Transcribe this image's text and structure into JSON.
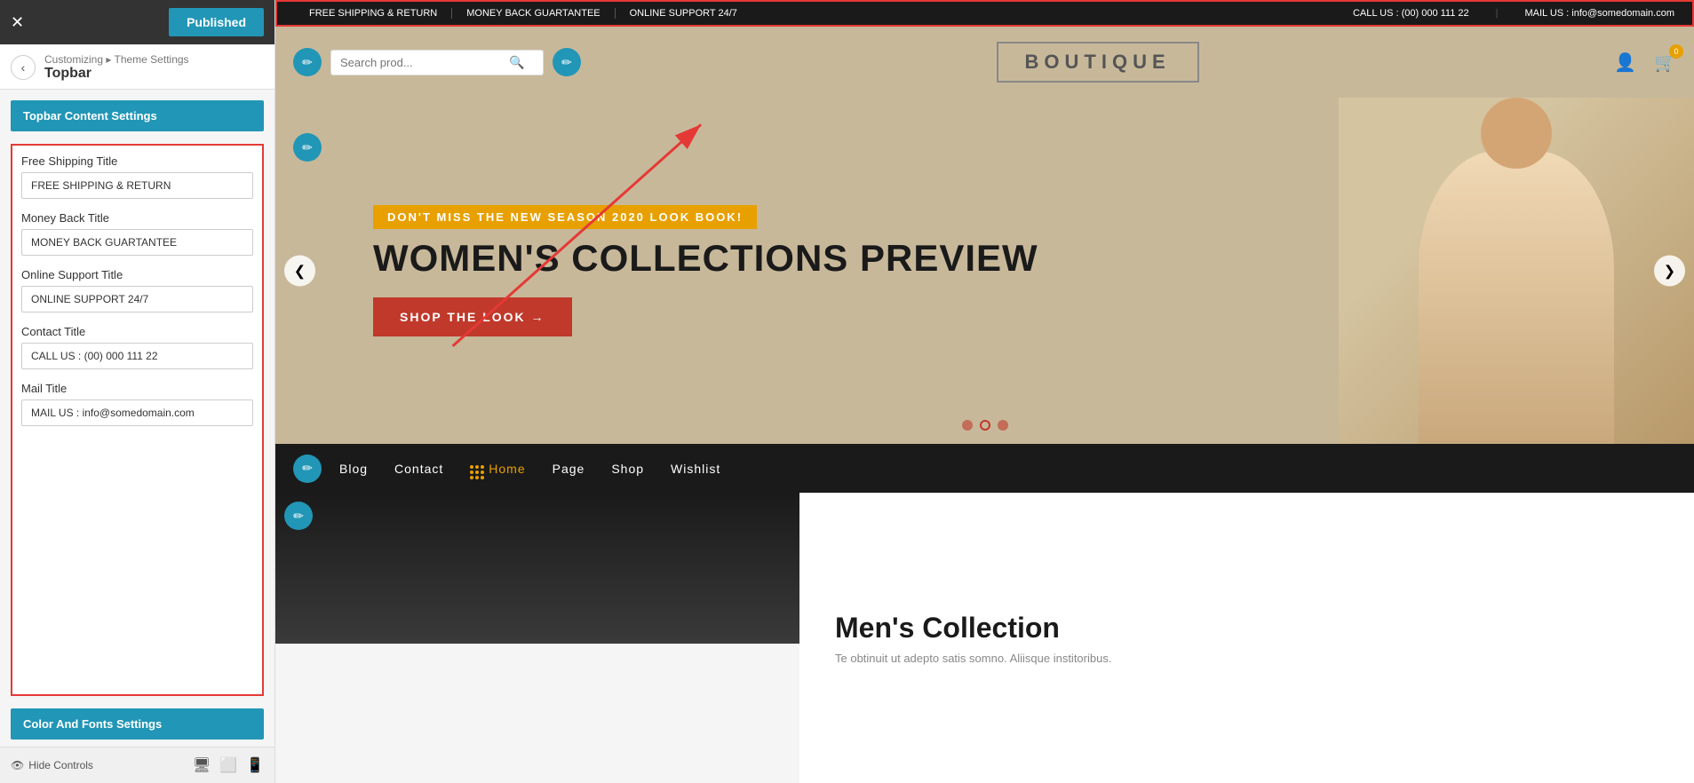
{
  "panel": {
    "close_label": "✕",
    "published_label": "Published",
    "breadcrumb": "Customizing ▸ Theme Settings",
    "title": "Topbar",
    "topbar_content_btn": "Topbar Content Settings",
    "fields": [
      {
        "id": "free_shipping",
        "label": "Free Shipping Title",
        "value": "FREE SHIPPING & RETURN"
      },
      {
        "id": "money_back",
        "label": "Money Back Title",
        "value": "MONEY BACK GUARTANTEE"
      },
      {
        "id": "online_support",
        "label": "Online Support Title",
        "value": "ONLINE SUPPORT 24/7"
      },
      {
        "id": "contact",
        "label": "Contact Title",
        "value": "CALL US : (00) 000 111 22"
      },
      {
        "id": "mail",
        "label": "Mail Title",
        "value": "MAIL US : info@somedomain.com"
      }
    ],
    "color_fonts_btn": "Color And Fonts Settings",
    "hide_controls": "Hide Controls"
  },
  "topbar": {
    "free_shipping": "FREE SHIPPING & RETURN",
    "money_back": "MONEY BACK GUARTANTEE",
    "online_support": "ONLINE SUPPORT 24/7",
    "call_us": "CALL US : (00) 000 111 22",
    "mail_us": "MAIL US : info@somedomain.com"
  },
  "header": {
    "search_placeholder": "Search prod...",
    "logo": "BOUTIQUE",
    "cart_count": "0"
  },
  "hero": {
    "subtitle": "DON'T MISS THE NEW SEASON 2020 LOOK BOOK!",
    "title": "WOMEN'S COLLECTIONS PREVIEW",
    "shop_btn": "SHOP THE LOOK →"
  },
  "nav": {
    "items": [
      {
        "label": "Blog",
        "active": false
      },
      {
        "label": "Contact",
        "active": false
      },
      {
        "label": "Home",
        "active": true
      },
      {
        "label": "Page",
        "active": false
      },
      {
        "label": "Shop",
        "active": false
      },
      {
        "label": "Wishlist",
        "active": false
      }
    ]
  },
  "bottom": {
    "title": "Men's Collection",
    "subtitle": "Te obtinuit ut adepto satis somno. Aliisque institoribus."
  },
  "icons": {
    "edit": "✏",
    "search": "🔍",
    "user": "👤",
    "cart": "🛒",
    "back": "‹",
    "prev": "❮",
    "next": "❯",
    "desktop": "🖥",
    "tablet": "⬜",
    "mobile": "📱",
    "eye": "👁"
  }
}
